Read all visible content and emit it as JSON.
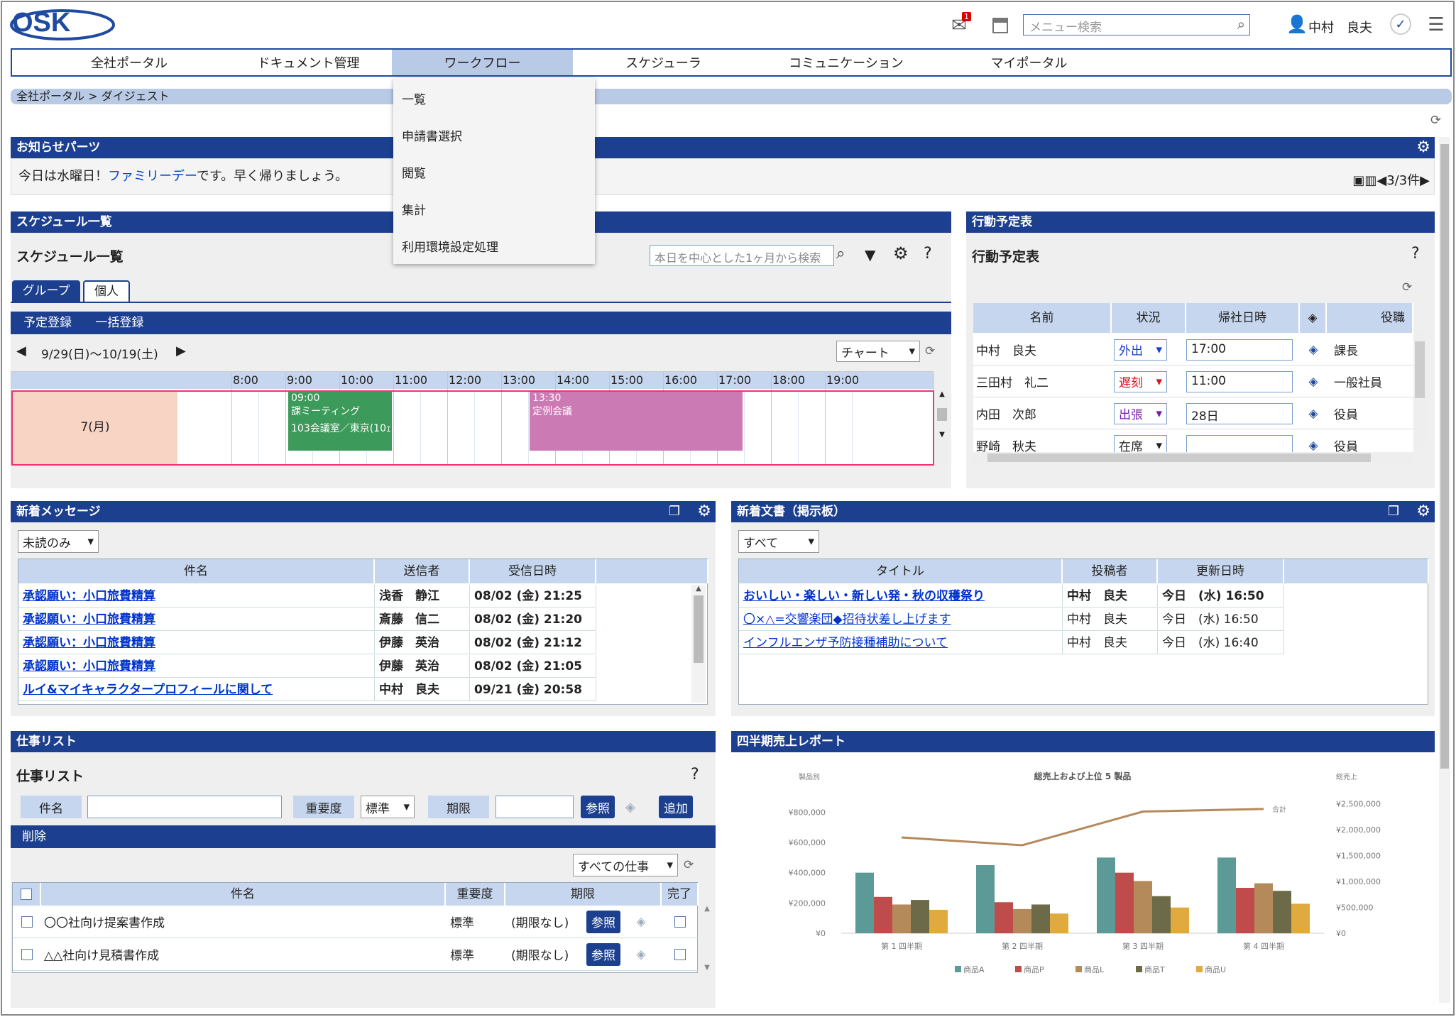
{
  "header": {
    "logo": "OSK",
    "search_placeholder": "メニュー検索",
    "user_name": "中村　良夫",
    "mail_badge": "1"
  },
  "nav": {
    "items": [
      "全社ポータル",
      "ドキュメント管理",
      "ワークフロー",
      "スケジューラ",
      "コミュニケーション",
      "マイポータル"
    ],
    "active_index": 2,
    "dropdown": [
      "一覧",
      "申請書選択",
      "閲覧",
      "集計",
      "利用環境設定処理"
    ]
  },
  "breadcrumb": "全社ポータル > ダイジェスト",
  "notice": {
    "title": "お知らせパーツ",
    "text_before": "今日は水曜日！",
    "link": "ファミリーデー",
    "text_after": "です。早く帰りましょう。",
    "pager": "3/3件"
  },
  "schedule": {
    "header": "スケジュール一覧",
    "title": "スケジュール一覧",
    "search_placeholder": "本日を中心とした1ヶ月から検索",
    "tabs": [
      "グループ",
      "個人"
    ],
    "actions": [
      "予定登録",
      "一括登録"
    ],
    "range": "9/29(日)～10/19(土)",
    "view_select": "チャート",
    "times": [
      "8:00",
      "9:00",
      "10:00",
      "11:00",
      "12:00",
      "13:00",
      "14:00",
      "15:00",
      "16:00",
      "17:00",
      "18:00",
      "19:00"
    ],
    "day": "7(月)",
    "events": [
      {
        "time": "09:00",
        "title": "課ミーティング",
        "place": "103会議室／東京(10ｪ",
        "color": "#3c9a5a"
      },
      {
        "time": "13:30",
        "title": "定例会議",
        "place": "",
        "color": "#cc7ab4"
      }
    ]
  },
  "action_table": {
    "header": "行動予定表",
    "title": "行動予定表",
    "columns": [
      "名前",
      "状況",
      "帰社日時",
      "役職"
    ],
    "rows": [
      {
        "name": "中村　良夫",
        "status": "外出",
        "status_color": "#1a3fcc",
        "return": "17:00",
        "role": "課長"
      },
      {
        "name": "三田村　礼二",
        "status": "遅刻",
        "status_color": "#dd1122",
        "return": "11:00",
        "role": "一般社員"
      },
      {
        "name": "内田　次郎",
        "status": "出張",
        "status_color": "#7a1aa8",
        "return": "28日",
        "role": "役員"
      },
      {
        "name": "野崎　秋夫",
        "status": "在席",
        "status_color": "#222222",
        "return": "",
        "role": "役員"
      }
    ]
  },
  "messages": {
    "header": "新着メッセージ",
    "filter": "未読のみ",
    "columns": [
      "件名",
      "送信者",
      "受信日時"
    ],
    "rows": [
      {
        "subject": "承認願い：小口旅費精算",
        "sender": "浅香　静江",
        "date": "08/02 (金) 21:25"
      },
      {
        "subject": "承認願い：小口旅費精算",
        "sender": "斎藤　信二",
        "date": "08/02 (金) 21:20"
      },
      {
        "subject": "承認願い：小口旅費精算",
        "sender": "伊藤　英治",
        "date": "08/02 (金) 21:12"
      },
      {
        "subject": "承認願い：小口旅費精算",
        "sender": "伊藤　英治",
        "date": "08/02 (金) 21:05"
      },
      {
        "subject": "ルイ&マイキャラクタープロフィールに関して",
        "sender": "中村　良夫",
        "date": "09/21 (金) 20:58"
      }
    ]
  },
  "documents": {
    "header": "新着文書（掲示板）",
    "filter": "すべて",
    "columns": [
      "タイトル",
      "投稿者",
      "更新日時"
    ],
    "rows": [
      {
        "title": "おいしい・楽しい・新しい発・秋の収穫祭り",
        "author": "中村　良夫",
        "date": "今日　(水) 16:50",
        "bold": true
      },
      {
        "title": "〇×△=交響楽団◆招待状差し上げます",
        "author": "中村　良夫",
        "date": "今日　(水) 16:50",
        "bold": false
      },
      {
        "title": "インフルエンザ予防接種補助について",
        "author": "中村　良夫",
        "date": "今日　(水) 16:40",
        "bold": false
      }
    ]
  },
  "tasks": {
    "header": "仕事リスト",
    "title": "仕事リスト",
    "labels": {
      "subject": "件名",
      "priority": "重要度",
      "due": "期限",
      "ref": "参照",
      "add": "追加",
      "delete": "削除"
    },
    "priority_value": "標準",
    "filter": "すべての仕事",
    "columns": [
      "件名",
      "重要度",
      "期限",
      "完了"
    ],
    "rows": [
      {
        "subject": "〇〇社向け提案書作成",
        "priority": "標準",
        "due": "(期限なし)"
      },
      {
        "subject": "△△社向け見積書作成",
        "priority": "標準",
        "due": "(期限なし)"
      }
    ]
  },
  "report": {
    "header": "四半期売上レポート"
  },
  "chart_data": {
    "type": "bar",
    "title": "総売上および上位 5 製品",
    "ylabel": "製品別",
    "y2label": "総売上",
    "categories": [
      "第 1 四半期",
      "第 2 四半期",
      "第 3 四半期",
      "第 4 四半期"
    ],
    "ylim": [
      0,
      900000
    ],
    "yticks": [
      "¥0",
      "¥200,000",
      "¥400,000",
      "¥600,000",
      "¥800,000"
    ],
    "y2lim": [
      0,
      2500000
    ],
    "y2ticks": [
      "¥0",
      "¥500,000",
      "¥1,000,000",
      "¥1,500,000",
      "¥2,000,000",
      "¥2,500,000"
    ],
    "series": [
      {
        "name": "商品A",
        "color": "#5b9a96",
        "values": [
          400000,
          450000,
          500000,
          500000
        ]
      },
      {
        "name": "商品P",
        "color": "#c04b4b",
        "values": [
          240000,
          205000,
          400000,
          300000
        ]
      },
      {
        "name": "商品L",
        "color": "#b58a5b",
        "values": [
          190000,
          160000,
          345000,
          330000
        ]
      },
      {
        "name": "商品T",
        "color": "#6c6a48",
        "values": [
          220000,
          190000,
          245000,
          280000
        ]
      },
      {
        "name": "商品U",
        "color": "#e0aa3e",
        "values": [
          155000,
          130000,
          170000,
          195000
        ]
      }
    ],
    "total": {
      "name": "合計",
      "color": "#b58a5b",
      "values": [
        1850000,
        1700000,
        2350000,
        2400000
      ]
    }
  }
}
